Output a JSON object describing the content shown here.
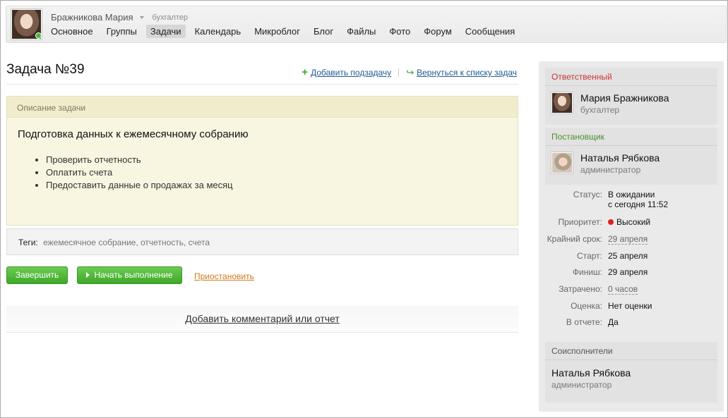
{
  "header": {
    "user_name": "Бражникова Мария",
    "user_role": "бухгалтер",
    "nav": [
      {
        "label": "Основное",
        "active": false
      },
      {
        "label": "Группы",
        "active": false
      },
      {
        "label": "Задачи",
        "active": true
      },
      {
        "label": "Календарь",
        "active": false
      },
      {
        "label": "Микроблог",
        "active": false
      },
      {
        "label": "Блог",
        "active": false
      },
      {
        "label": "Файлы",
        "active": false
      },
      {
        "label": "Фото",
        "active": false
      },
      {
        "label": "Форум",
        "active": false
      },
      {
        "label": "Сообщения",
        "active": false
      }
    ]
  },
  "task": {
    "title": "Задача №39",
    "add_subtask": "Добавить подзадачу",
    "back_to_list": "Вернуться к списку задач",
    "description_header": "Описание задачи",
    "description_title": "Подготовка данных к ежемесячному собранию",
    "items": [
      "Проверить отчетность",
      "Оплатить счета",
      "Предоставить данные о продажах за месяц"
    ],
    "tags_label": "Теги:",
    "tags_value": "ежемесячное собрание, отчетность, счета",
    "btn_finish": "Завершить",
    "btn_start": "Начать выполнение",
    "pause": "Приостановить",
    "add_comment": "Добавить комментарий или отчет"
  },
  "sidebar": {
    "responsible": {
      "heading": "Ответственный",
      "name": "Мария Бражникова",
      "role": "бухгалтер"
    },
    "creator": {
      "heading": "Постановщик",
      "name": "Наталья Рябкова",
      "role": "администратор"
    },
    "props": {
      "status_label": "Статус:",
      "status_value": "В ожидании",
      "status_since": "с сегодня 11:52",
      "priority_label": "Приоритет:",
      "priority_value": "Высокий",
      "deadline_label": "Крайний срок:",
      "deadline_value": "29 апреля",
      "start_label": "Старт:",
      "start_value": "25 апреля",
      "finish_label": "Финиш:",
      "finish_value": "29 апреля",
      "spent_label": "Затрачено:",
      "spent_value": "0 часов",
      "rating_label": "Оценка:",
      "rating_value": "Нет оценки",
      "report_label": "В отчете:",
      "report_value": "Да"
    },
    "coexecutors": {
      "heading": "Соисполнители",
      "name": "Наталья Рябкова",
      "role": "администратор"
    }
  }
}
